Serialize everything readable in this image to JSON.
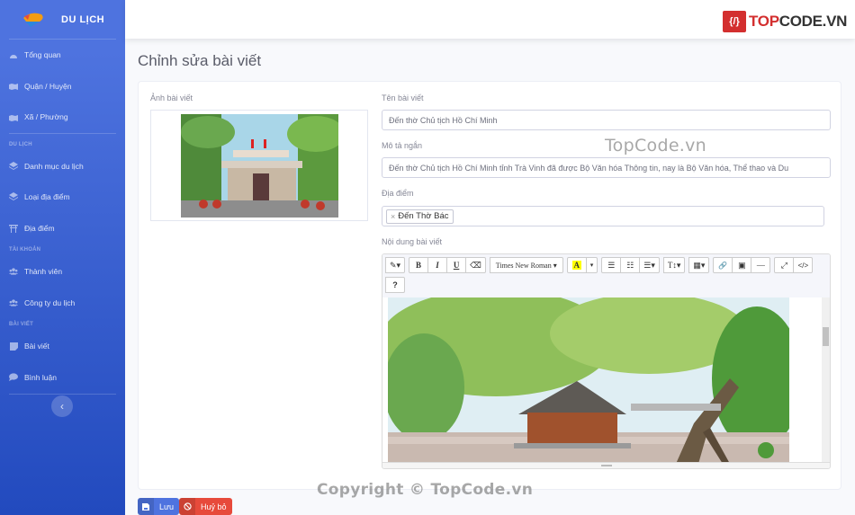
{
  "app": {
    "brand_name": "DU LỊCH",
    "colors": {
      "primary": "#4e73df",
      "danger": "#e74a3b",
      "sidebar_end": "#224abe"
    }
  },
  "sidebar": {
    "items_top": [
      {
        "label": "Tổng quan",
        "icon": "tachometer-icon"
      },
      {
        "label": "Quận / Huyện",
        "icon": "map-icon"
      },
      {
        "label": "Xã / Phường",
        "icon": "map-icon"
      }
    ],
    "sections": [
      {
        "heading": "DU LỊCH",
        "items": [
          {
            "label": "Danh mục du lịch",
            "icon": "layers-icon"
          },
          {
            "label": "Loại địa điểm",
            "icon": "layers-icon"
          },
          {
            "label": "Địa điểm",
            "icon": "torii-gate-icon"
          }
        ]
      },
      {
        "heading": "TÀI KHOẢN",
        "items": [
          {
            "label": "Thành viên",
            "icon": "users-icon"
          },
          {
            "label": "Công ty du lịch",
            "icon": "users-icon"
          }
        ]
      },
      {
        "heading": "BÀI VIẾT",
        "items": [
          {
            "label": "Bài viết",
            "icon": "note-icon"
          },
          {
            "label": "Bình luận",
            "icon": "comment-icon"
          }
        ]
      }
    ],
    "toggle_icon": "‹"
  },
  "topbar": {
    "logo_prefix": "TOP",
    "logo_suffix": "CODE.VN",
    "logo_glyph": "{/}"
  },
  "page": {
    "title": "Chỉnh sửa bài viết"
  },
  "form": {
    "image_label": "Ảnh bài viết",
    "name_label": "Tên bài viết",
    "name_value": "Đến thờ Chủ tịch Hồ Chí Minh",
    "desc_label": "Mô tả ngắn",
    "desc_value": "Đến thờ Chủ tịch Hồ Chí Minh tỉnh Trà Vinh đã được Bộ Văn hóa Thông tin, nay là Bộ Văn hóa, Thể thao và Du",
    "location_label": "Địa điểm",
    "location_tags": [
      "Đến Thờ Bác"
    ],
    "content_label": "Nội dung bài viết",
    "toolbar": {
      "style": "✎▾",
      "bold": "B",
      "italic": "I",
      "underline": "U",
      "eraser": "⌫",
      "font": "Times New Roman ▾",
      "color": "A",
      "color_caret": "▾",
      "ul": "☰",
      "ol": "☷",
      "align": "☰▾",
      "height": "T↕▾",
      "table": "▦▾",
      "link": "🔗",
      "picture": "▣",
      "hr": "—",
      "fullscreen": "⤢",
      "code": "</>",
      "help": "?"
    }
  },
  "actions": {
    "save_label": "Lưu",
    "cancel_label": "Huỷ bỏ"
  },
  "watermarks": {
    "center": "TopCode.vn",
    "bottom": "Copyright © TopCode.vn"
  }
}
